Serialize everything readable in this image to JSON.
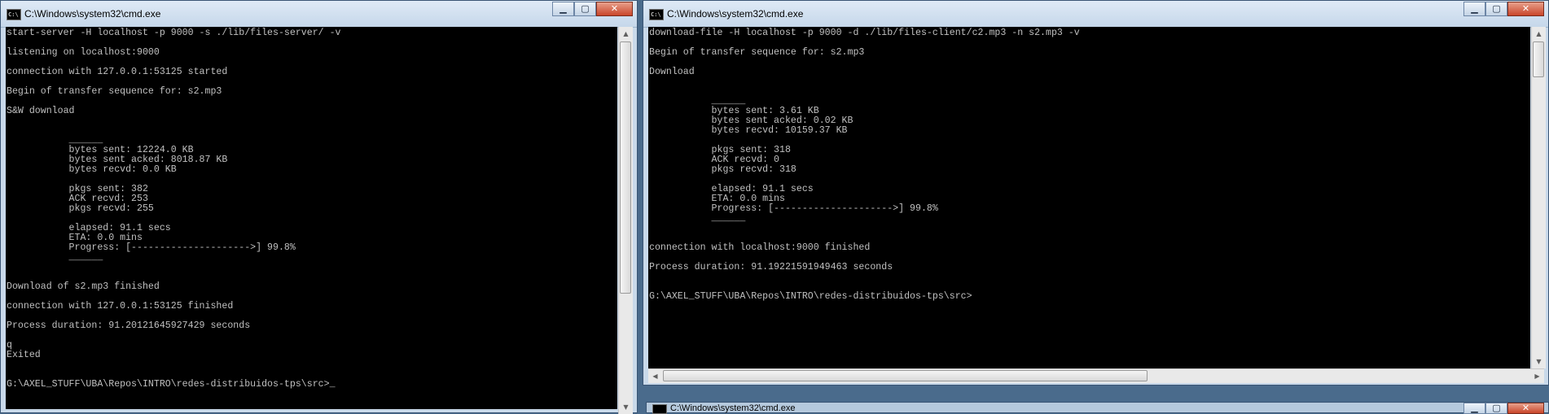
{
  "left_window": {
    "title": "C:\\Windows\\system32\\cmd.exe",
    "icon_label": "C:\\",
    "controls": {
      "minimize": "▁",
      "maximize": "▢",
      "close": "✕"
    },
    "console_text": "start-server -H localhost -p 9000 -s ./lib/files-server/ -v\n\nlistening on localhost:9000\n\nconnection with 127.0.0.1:53125 started\n\nBegin of transfer sequence for: s2.mp3\n\nS&W download\n\n\n           ______\n           bytes sent: 12224.0 KB\n           bytes sent acked: 8018.87 KB\n           bytes recvd: 0.0 KB\n\n           pkgs sent: 382\n           ACK recvd: 253\n           pkgs recvd: 255\n\n           elapsed: 91.1 secs\n           ETA: 0.0 mins\n           Progress: [--------------------->] 99.8%\n           ______\n\n\nDownload of s2.mp3 finished\n\nconnection with 127.0.0.1:53125 finished\n\nProcess duration: 91.20121645927429 seconds\n\nq\nExited\n\n\nG:\\AXEL_STUFF\\UBA\\Repos\\INTRO\\redes-distribuidos-tps\\src>",
    "cursor": "_"
  },
  "right_window": {
    "title": "C:\\Windows\\system32\\cmd.exe",
    "icon_label": "C:\\",
    "controls": {
      "minimize": "▁",
      "maximize": "▢",
      "close": "✕"
    },
    "console_text": "download-file -H localhost -p 9000 -d ./lib/files-client/c2.mp3 -n s2.mp3 -v\n\nBegin of transfer sequence for: s2.mp3\n\nDownload\n\n\n           ______\n           bytes sent: 3.61 KB\n           bytes sent acked: 0.02 KB\n           bytes recvd: 10159.37 KB\n\n           pkgs sent: 318\n           ACK recvd: 0\n           pkgs recvd: 318\n\n           elapsed: 91.1 secs\n           ETA: 0.0 mins\n           Progress: [--------------------->] 99.8%\n           ______\n\n\nconnection with localhost:9000 finished\n\nProcess duration: 91.19221591949463 seconds\n\n\nG:\\AXEL_STUFF\\UBA\\Repos\\INTRO\\redes-distribuidos-tps\\src>"
  },
  "bottom_window": {
    "title": "C:\\Windows\\system32\\cmd.exe",
    "controls": {
      "minimize": "▁",
      "maximize": "▢",
      "close": "✕"
    }
  },
  "colors": {
    "console_background": "#000000",
    "console_text": "#c0c0c0",
    "title_bar": "#c9d9ea",
    "close_button": "#c9452a"
  }
}
